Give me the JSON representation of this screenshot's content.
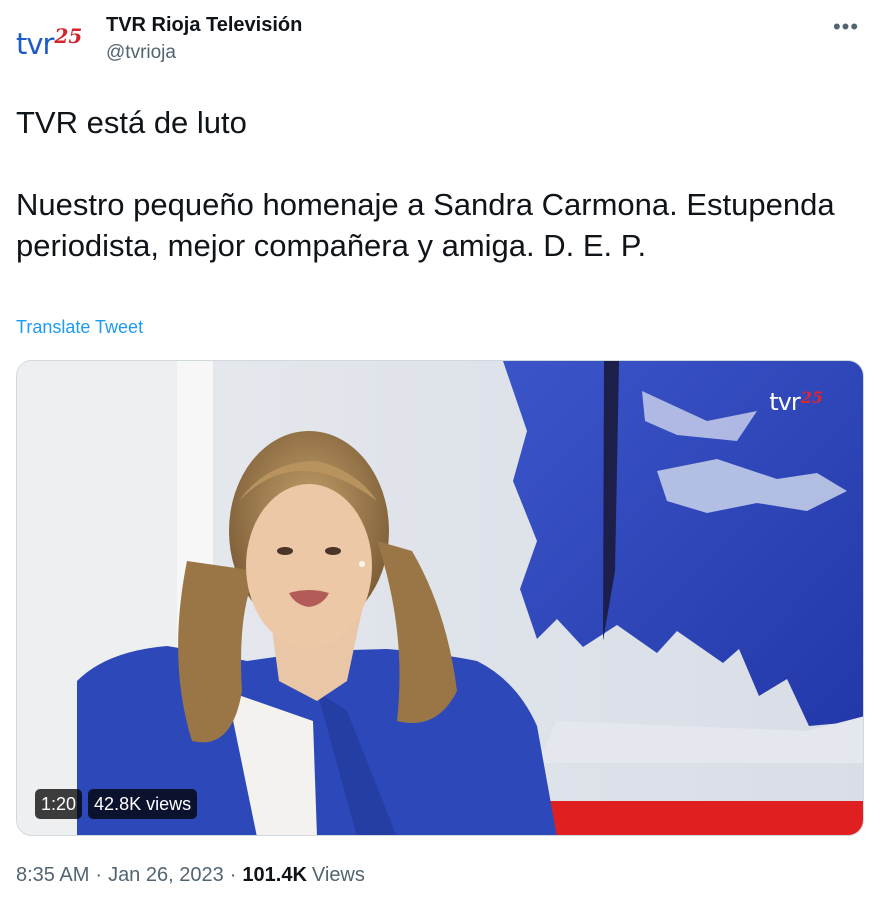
{
  "account": {
    "avatar_logo_main": "tvr",
    "avatar_logo_number": "25",
    "display_name": "TVR Rioja Televisión",
    "handle": "@tvrioja"
  },
  "tweet": {
    "text": "TVR está de luto\n\nNuestro pequeño homenaje a Sandra Carmona. Estupenda periodista, mejor compañera y amiga. D. E. P.",
    "translate_label": "Translate Tweet"
  },
  "video": {
    "logo_main": "tvr",
    "logo_number": "25",
    "duration": "1:20",
    "views": "42.8K views"
  },
  "meta": {
    "time": "8:35 AM",
    "separator": "·",
    "date": "Jan 26, 2023",
    "views_count": "101.4K",
    "views_label": "Views"
  },
  "icons": {
    "more": "more-horizontal-icon"
  },
  "colors": {
    "brand_blue": "#1d5cc5",
    "brand_red": "#d0262d",
    "link": "#1d9bf0",
    "secondary_text": "#536471"
  }
}
